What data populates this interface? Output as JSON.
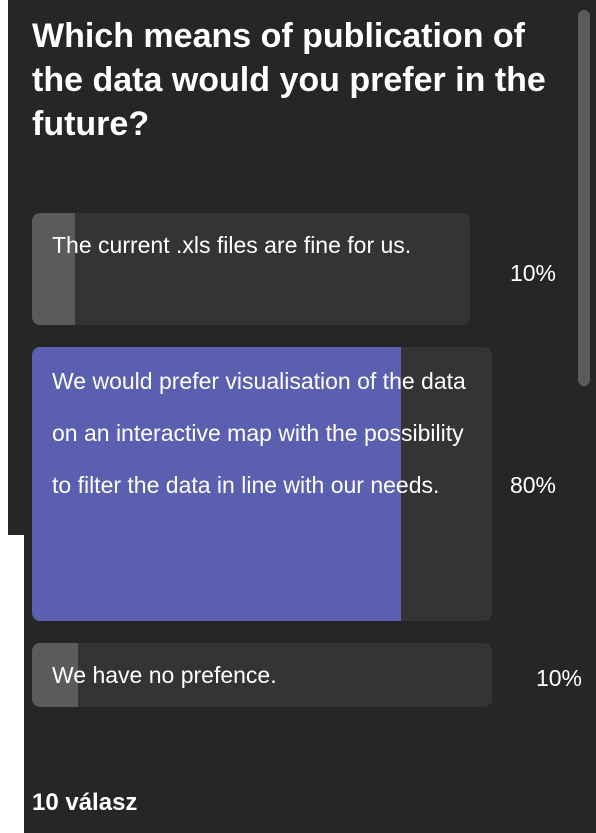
{
  "poll": {
    "question": "Which means of publication of the data would you prefer in the future?",
    "options": [
      {
        "label": "The current .xls files are fine for us.",
        "percent_text": "10%",
        "share": 0.1,
        "selected": false
      },
      {
        "label": "We would prefer visualisation of the data on an interactive map with the possibility to filter the data in line with our needs.",
        "percent_text": "80%",
        "share": 0.8,
        "selected": true
      },
      {
        "label": "We have no prefence.",
        "percent_text": "10%",
        "share": 0.1,
        "selected": false
      }
    ],
    "response_count": "10 válasz"
  },
  "colors": {
    "background": "#262626",
    "option_bg": "#343434",
    "bar_fill": "#5b5b5b",
    "selected_fill": "#5b5fb0",
    "text": "#ffffff"
  }
}
